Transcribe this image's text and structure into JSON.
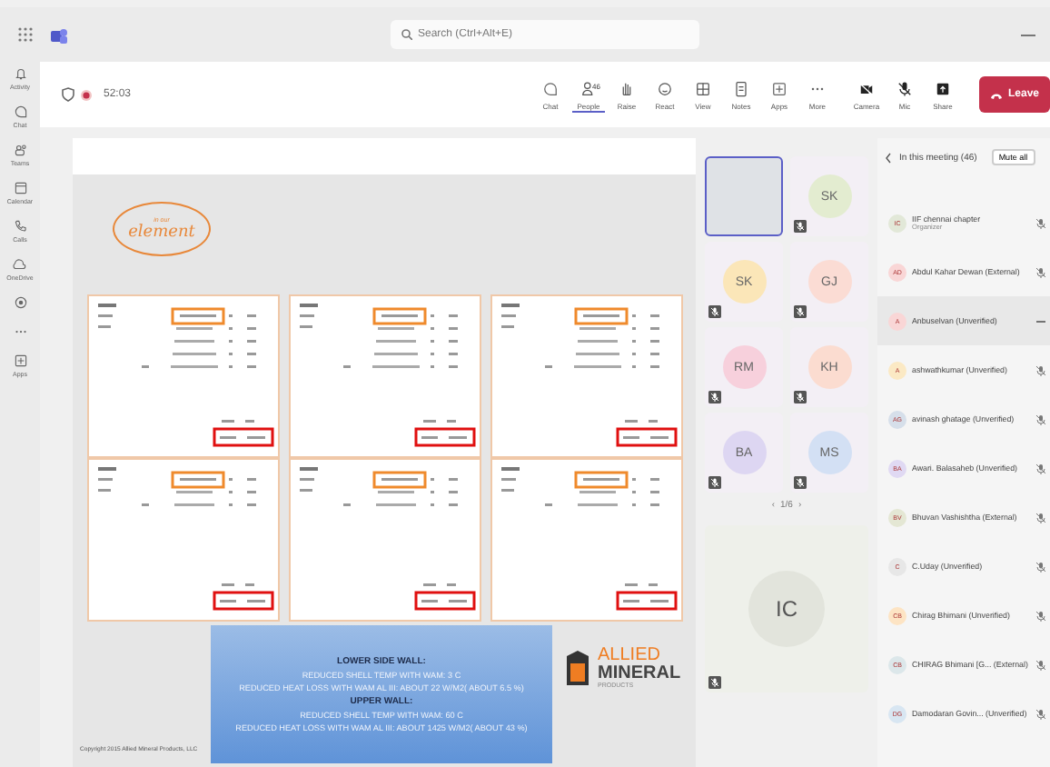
{
  "titlebar": {
    "search": {
      "placeholder": "Search (Ctrl+Alt+E)"
    }
  },
  "rail": [
    {
      "kind": "bell",
      "label": "Activity"
    },
    {
      "kind": "chat",
      "label": "Chat"
    },
    {
      "kind": "teams",
      "label": "Teams"
    },
    {
      "kind": "calendar",
      "label": "Calendar"
    },
    {
      "kind": "phone",
      "label": "Calls"
    },
    {
      "kind": "cloud",
      "label": "OneDrive"
    },
    {
      "kind": "app"
    },
    {
      "kind": "dots"
    },
    {
      "kind": "plus",
      "label": "Apps"
    }
  ],
  "meeting": {
    "timer": "52:03",
    "recording": true,
    "tools": [
      {
        "kind": "chat",
        "label": "Chat",
        "selected": false
      },
      {
        "kind": "people",
        "label": "People",
        "badge": "46",
        "selected": true
      },
      {
        "kind": "hand",
        "label": "Raise",
        "selected": false
      },
      {
        "kind": "smile",
        "label": "React",
        "selected": false
      },
      {
        "kind": "grid",
        "label": "View",
        "selected": false
      },
      {
        "kind": "notes",
        "label": "Notes",
        "selected": false
      },
      {
        "kind": "plus",
        "label": "Apps",
        "selected": false
      },
      {
        "kind": "dots",
        "label": "More",
        "selected": false
      },
      {
        "kind": "camera",
        "label": "Camera",
        "selected": false
      },
      {
        "kind": "mic",
        "label": "Mic",
        "selected": false
      },
      {
        "kind": "share",
        "label": "Share",
        "selected": false
      }
    ],
    "leave": "Leave"
  },
  "slide": {
    "logo": {
      "small": "in our",
      "word": "element"
    },
    "callout": [
      {
        "kind": "heading",
        "text": "LOWER SIDE WALL:"
      },
      {
        "kind": "line",
        "text": "REDUCED SHELL TEMP WITH WAM: 3 C"
      },
      {
        "kind": "line",
        "text": "REDUCED HEAT LOSS WITH WAM AL III: ABOUT 22 W/M2( ABOUT 6.5 %)"
      },
      {
        "kind": "heading",
        "text": "UPPER WALL:"
      },
      {
        "kind": "line",
        "text": "REDUCED SHELL TEMP WITH WAM: 60 C"
      },
      {
        "kind": "line",
        "text": "REDUCED HEAT LOSS WITH WAM AL III: ABOUT 1425 W/M2( ABOUT 43 %)"
      }
    ],
    "brand": {
      "line1": "ALLIED",
      "line2": "MINERAL",
      "line3": "PRODUCTS"
    },
    "copyright": "Copyright 2015 Allied Mineral Products, LLC"
  },
  "video_grid": {
    "tiles": [
      {
        "kind": "camera"
      },
      {
        "kind": "avatar",
        "initials": "SK",
        "color": "#e3ecd0"
      },
      {
        "kind": "avatar",
        "initials": "SK",
        "color": "#fbe6b8"
      },
      {
        "kind": "avatar",
        "initials": "GJ",
        "color": "#fbdcd4"
      },
      {
        "kind": "avatar",
        "initials": "RM",
        "color": "#f7d0dc"
      },
      {
        "kind": "avatar",
        "initials": "KH",
        "color": "#fbdcd0"
      },
      {
        "kind": "avatar",
        "initials": "BA",
        "color": "#ddd6f2"
      },
      {
        "kind": "avatar",
        "initials": "MS",
        "color": "#d3e0f4"
      }
    ],
    "pager": {
      "prev": "‹",
      "page": "1/6",
      "next": "›"
    },
    "main_tile": {
      "initials": "IC",
      "color": "#e2e4dc"
    }
  },
  "participants": {
    "title": "In this meeting (46)",
    "mute_all": "Mute all",
    "people": [
      {
        "initials": "IC",
        "name": "IIF chennai chapter",
        "role": "Organizer",
        "color": "#e2e8d8",
        "selected": false,
        "muted": true
      },
      {
        "initials": "AD",
        "name": "Abdul Kahar Dewan (External)",
        "color": "#f9d6d6",
        "selected": false,
        "muted": true
      },
      {
        "initials": "A",
        "name": "Anbuselvan (Unverified)",
        "color": "#f9d6d6",
        "selected": true
      },
      {
        "initials": "A",
        "name": "ashwathkumar (Unverified)",
        "color": "#fbe9c4",
        "selected": false,
        "muted": true
      },
      {
        "initials": "AG",
        "name": "avinash ghatage (Unverified)",
        "color": "#d6dfea",
        "selected": false,
        "muted": true
      },
      {
        "initials": "BA",
        "name": "Awari. Balasaheb (Unverified)",
        "color": "#e0d9f3",
        "selected": false,
        "muted": true
      },
      {
        "initials": "BV",
        "name": "Bhuvan Vashishtha (External)",
        "color": "#e4e7d4",
        "selected": false,
        "muted": true
      },
      {
        "initials": "C",
        "name": "C.Uday (Unverified)",
        "color": "#e7e7e7",
        "selected": false,
        "muted": true
      },
      {
        "initials": "CB",
        "name": "Chirag Bhimani (Unverified)",
        "color": "#fde4c4",
        "selected": false,
        "muted": true
      },
      {
        "initials": "CB",
        "name": "CHIRAG Bhimani [G... (External)",
        "color": "#dce7ea",
        "selected": false,
        "muted": true
      },
      {
        "initials": "DG",
        "name": "Damodaran Govin... (Unverified)",
        "color": "#d8e6f2",
        "selected": false,
        "muted": true
      }
    ]
  }
}
